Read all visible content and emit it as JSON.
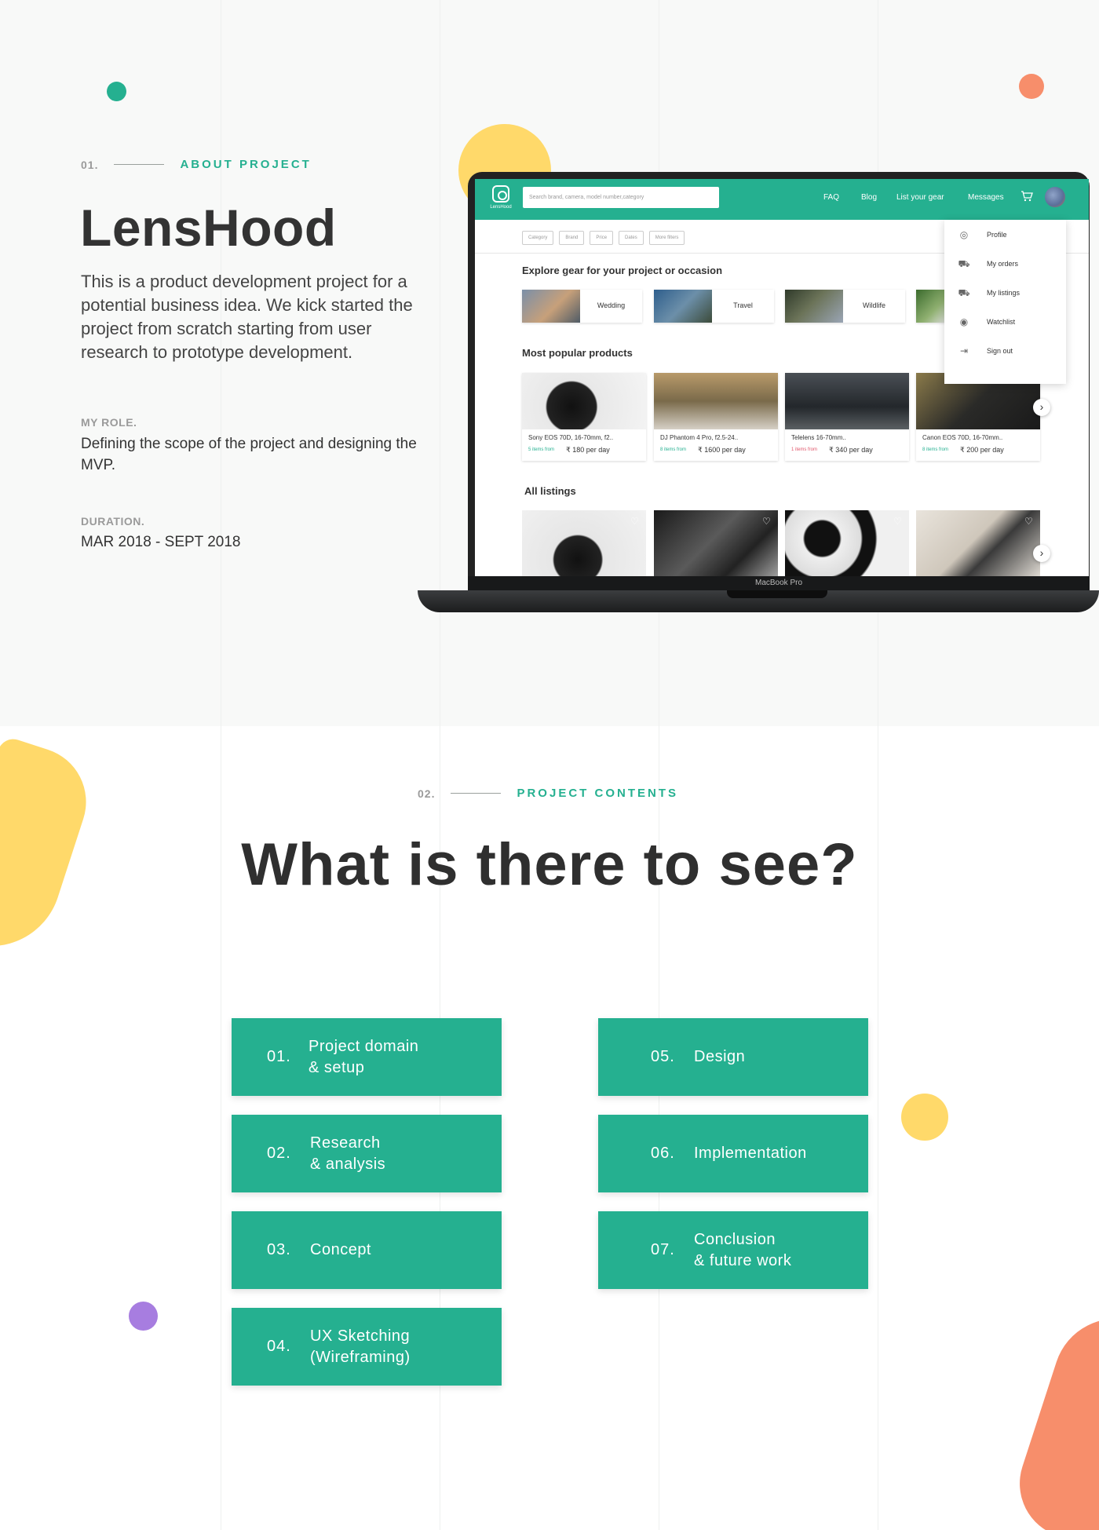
{
  "about": {
    "num": "01.",
    "label": "ABOUT PROJECT",
    "title": "LensHood",
    "description": "This is a product development project for a potential business idea. We kick started the project from scratch starting from user research to prototype development.",
    "role_label": "MY ROLE.",
    "role_value": "Defining the scope of the project and designing the MVP.",
    "duration_label": "DURATION.",
    "duration_value": "MAR 2018 - SEPT 2018"
  },
  "mockup": {
    "device_label": "MacBook Pro",
    "logo_text": "LensHood",
    "search_placeholder": "Search brand, camera, model number,category",
    "nav": [
      "FAQ",
      "Blog",
      "List your gear",
      "Messages"
    ],
    "filters": [
      "Category",
      "Brand",
      "Price",
      "Dates",
      "More filters"
    ],
    "explore_heading": "Explore gear for your project or occasion",
    "occasions": [
      "Wedding",
      "Travel",
      "Wildlife"
    ],
    "popular_heading": "Most popular products",
    "products": [
      {
        "name": "Sony EOS 70D, 16-70mm, f2..",
        "from": "5 items from",
        "price": "₹ 180 per day",
        "from_color": "#25b090"
      },
      {
        "name": "DJ Phantom 4 Pro, f2.5-24..",
        "from": "8 items from",
        "price": "₹ 1600 per day",
        "from_color": "#25b090"
      },
      {
        "name": "Telelens 16-70mm..",
        "from": "1 items from",
        "price": "₹ 340 per day",
        "from_color": "#e0566a"
      },
      {
        "name": "Canon EOS 70D, 16-70mm..",
        "from": "8 items from",
        "price": "₹ 200 per day",
        "from_color": "#25b090"
      }
    ],
    "listings_heading": "All listings",
    "menu": [
      {
        "label": "Profile",
        "icon": "user-circle-icon"
      },
      {
        "label": "My orders",
        "icon": "cart-icon"
      },
      {
        "label": "My listings",
        "icon": "cart-list-icon"
      },
      {
        "label": "Watchlist",
        "icon": "eye-icon"
      },
      {
        "label": "Sign out",
        "icon": "sign-out-icon"
      }
    ]
  },
  "contents": {
    "num": "02.",
    "label": "PROJECT CONTENTS",
    "title": "What is there to see?",
    "items": [
      {
        "num": "01.",
        "label": "Project domain\n& setup"
      },
      {
        "num": "02.",
        "label": "Research\n& analysis"
      },
      {
        "num": "03.",
        "label": "Concept"
      },
      {
        "num": "04.",
        "label": "UX Sketching\n(Wireframing)"
      },
      {
        "num": "05.",
        "label": "Design"
      },
      {
        "num": "06.",
        "label": "Implementation"
      },
      {
        "num": "07.",
        "label": "Conclusion\n& future work"
      }
    ]
  },
  "colors": {
    "accent": "#25b090",
    "yellow": "#ffd96a",
    "orange": "#f78e6b",
    "purple": "#a77de0"
  }
}
